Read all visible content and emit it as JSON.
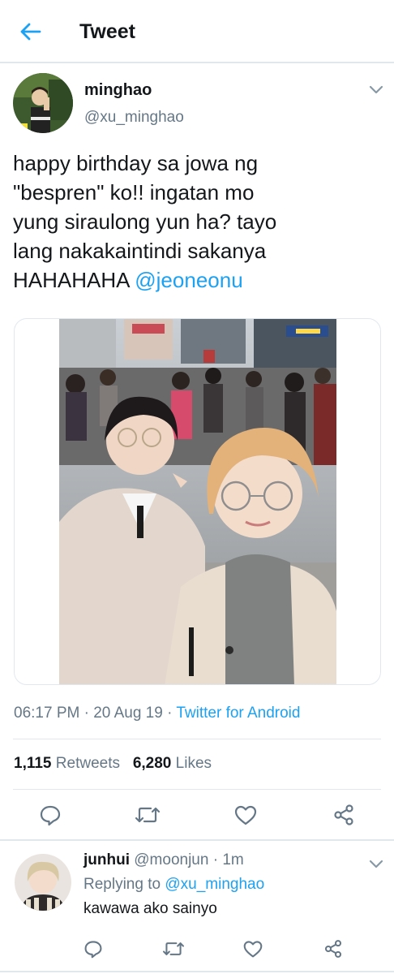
{
  "header": {
    "title": "Tweet",
    "back_icon": "arrow-left-icon"
  },
  "tweet": {
    "author_name": "minghao",
    "author_handle": "@xu_minghao",
    "text_lines": [
      "happy birthday sa jowa ng",
      "\"bespren\" ko!! ingatan mo",
      "yung siraulong yun ha? tayo",
      "lang nakakaintindi sakanya"
    ],
    "text_last": "HAHAHAHA ",
    "mention": "@jeoneonu",
    "time": "06:17 PM · 20 Aug 19 · ",
    "source": "Twitter for Android",
    "retweets_count": "1,115",
    "retweets_label": " Retweets",
    "likes_count": "6,280",
    "likes_label": " Likes"
  },
  "reply": {
    "author_name": "junhui",
    "author_handle": "@moonjun · 1m",
    "replying_prefix": "Replying to ",
    "replying_to": "@xu_minghao",
    "text": "kawawa ako sainyo"
  },
  "colors": {
    "accent": "#1da1f2",
    "secondary": "#657786",
    "text": "#14171a",
    "border": "#e1e8ed"
  }
}
